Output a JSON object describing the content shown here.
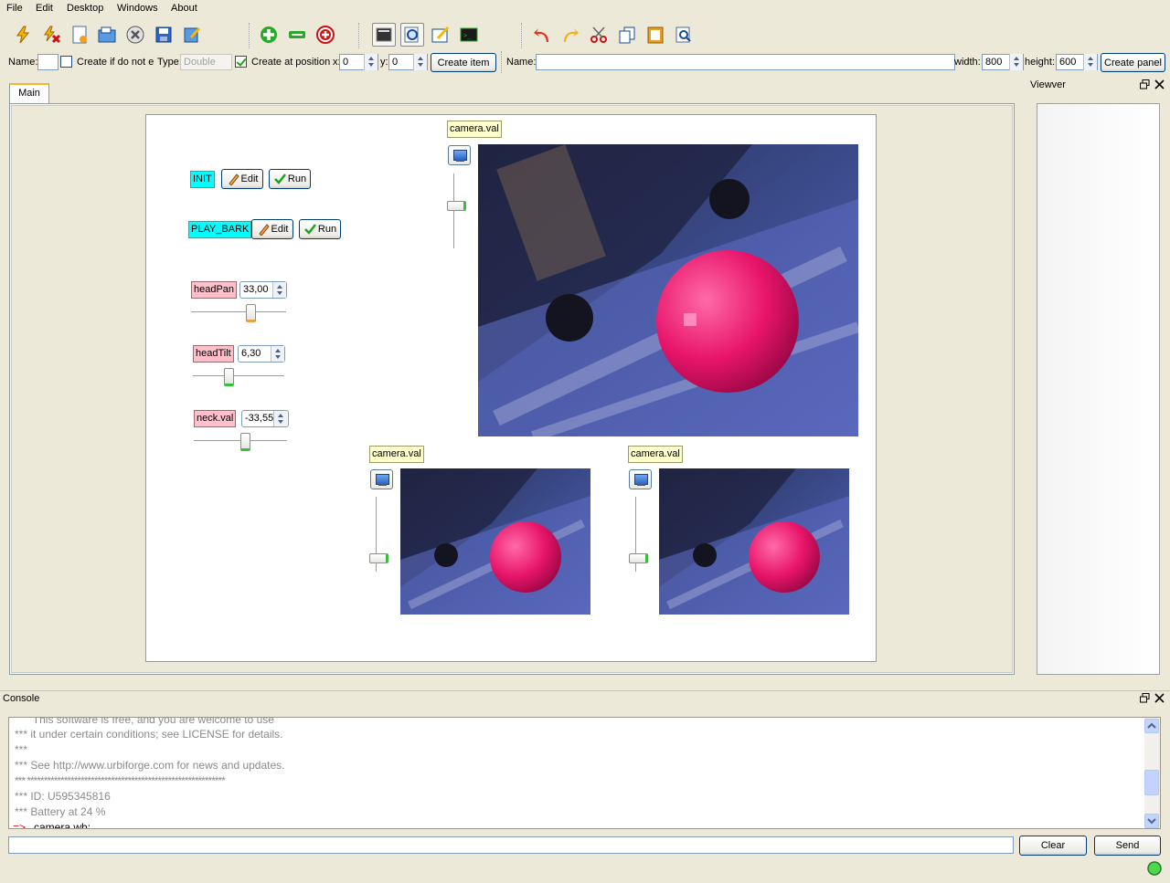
{
  "menu": [
    "File",
    "Edit",
    "Desktop",
    "Windows",
    "About"
  ],
  "toolbar": {
    "icons": [
      "connect-icon",
      "disconnect-icon",
      "new-icon",
      "open-icon",
      "close-icon",
      "save-icon",
      "edit-icon",
      "add-icon",
      "remove-icon",
      "delete-icon",
      "console-icon",
      "zoom-icon",
      "editor-icon",
      "terminal-icon",
      "undo-icon",
      "redo-icon",
      "cut-icon",
      "copy-icon",
      "paste-icon",
      "find-icon"
    ]
  },
  "itembar": {
    "name_label": "Name:",
    "name_value": "",
    "create_if_label": "Create if do not e",
    "type_label": "Type:",
    "type_value": "Double",
    "create_at_label": "Create at position",
    "x_label": "x:",
    "x_value": "0",
    "y_label": "y:",
    "y_value": "0",
    "create_item": "Create item"
  },
  "panelbar": {
    "name_label": "Name:",
    "name_value": "",
    "width_label": "width:",
    "width_value": "800",
    "height_label": "height:",
    "height_value": "600",
    "create_panel": "Create panel"
  },
  "tabs": [
    "Main"
  ],
  "panel": {
    "scripts": [
      {
        "name": "INIT",
        "edit": "Edit",
        "run": "Run"
      },
      {
        "name": "PLAY_BARK",
        "edit": "Edit",
        "run": "Run"
      }
    ],
    "variables": [
      {
        "name": "headPan",
        "value": "33,00",
        "level": 0.65
      },
      {
        "name": "headTilt",
        "value": "6,30",
        "level": 0.38
      },
      {
        "name": "neck.val",
        "value": "-33,55",
        "level": 0.56
      }
    ],
    "cameras": [
      {
        "name": "camera.val"
      },
      {
        "name": "camera.val"
      },
      {
        "name": "camera.val"
      }
    ]
  },
  "viewer": {
    "title": "Viewver"
  },
  "console": {
    "title": "Console",
    "lines": [
      "      This software is free, and you are welcome to use",
      "*** it under certain conditions; see LICENSE for details.",
      "***",
      "*** See http://www.urbiforge.com for news and updates.",
      "*** ***********************************************************",
      "*** ID: U595345816",
      "*** Battery at 24 %",
      "camera.wb;"
    ],
    "prompt": "=>",
    "input_value": "",
    "clear": "Clear",
    "send": "Send"
  },
  "status": {
    "connected_color": "#4cd94c"
  }
}
